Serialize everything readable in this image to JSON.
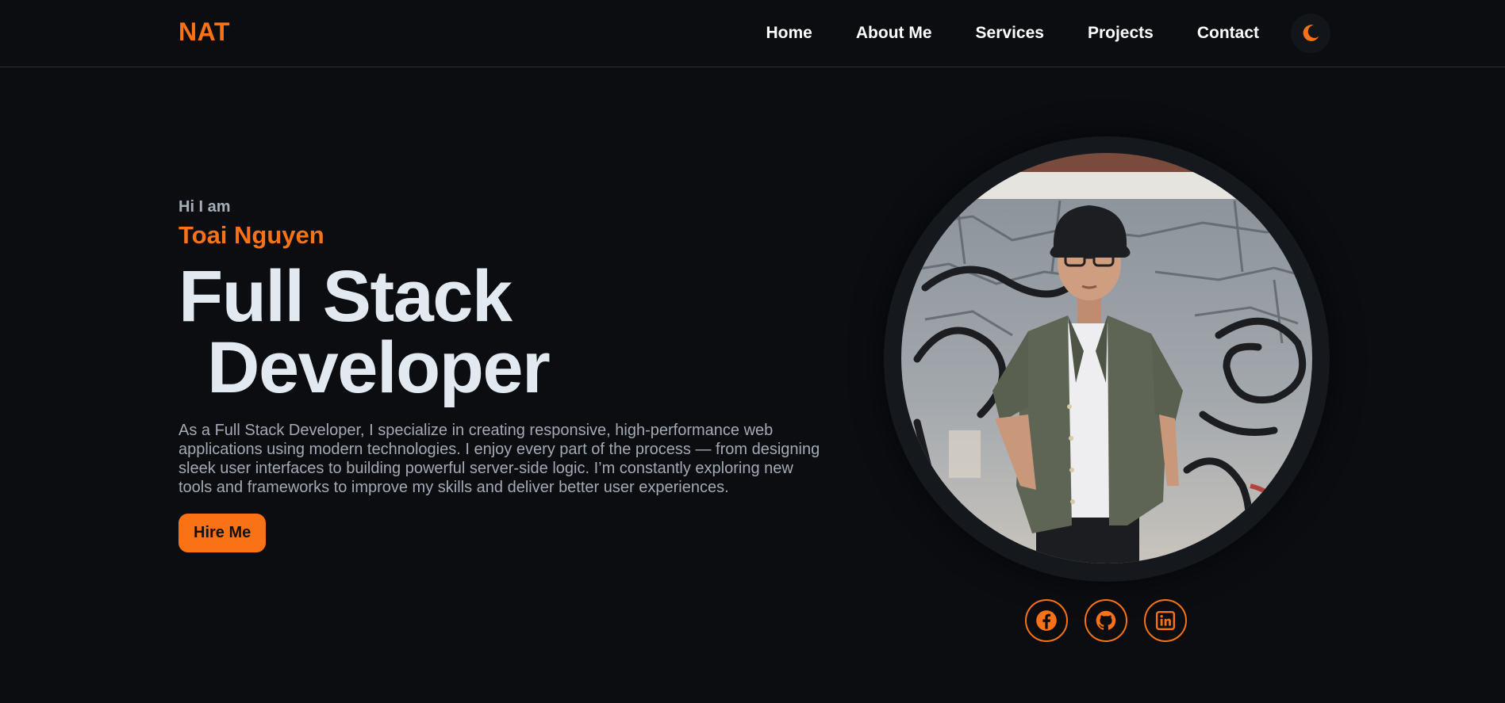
{
  "nav": {
    "logo": "NAT",
    "items": [
      {
        "label": "Home"
      },
      {
        "label": "About Me"
      },
      {
        "label": "Services"
      },
      {
        "label": "Projects"
      },
      {
        "label": "Contact"
      }
    ],
    "theme_icon": "moon-icon"
  },
  "hero": {
    "greeting": "Hi I am",
    "name": "Toai Nguyen",
    "title_line1": "Full Stack",
    "title_line2": "Developer",
    "description": "As a Full Stack Developer, I specialize in creating responsive, high-performance web applications using modern technologies. I enjoy every part of the process — from designing sleek user interfaces to building powerful server-side logic. I’m constantly exploring new tools and frameworks to improve my skills and deliver better user experiences.",
    "cta_label": "Hire Me"
  },
  "profile": {
    "photo_icon": "profile-photo"
  },
  "socials": [
    {
      "icon": "facebook-icon"
    },
    {
      "icon": "github-icon"
    },
    {
      "icon": "linkedin-icon"
    }
  ],
  "colors": {
    "accent": "#f97316",
    "background": "#0b0d11"
  }
}
